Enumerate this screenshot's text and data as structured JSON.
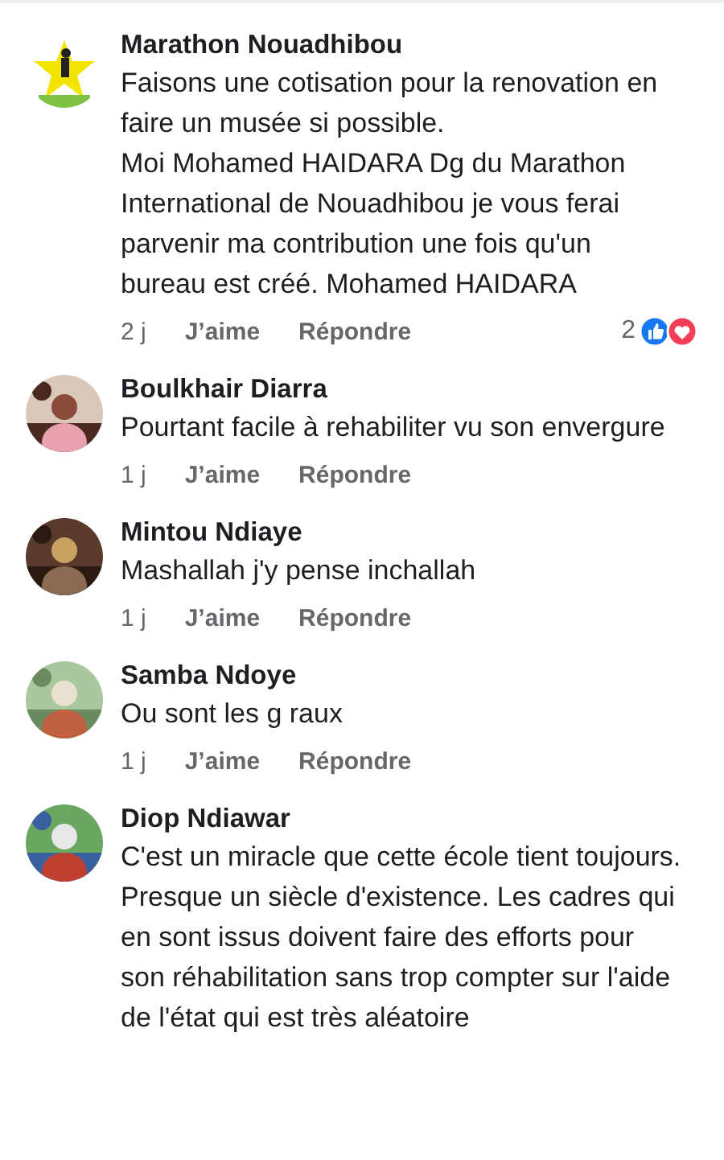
{
  "comments": [
    {
      "author": "Marathon Nouadhibou",
      "text": "Faisons une cotisation pour la renovation en faire un musée si possible.\nMoi Mohamed HAIDARA Dg du Marathon International de Nouadhibou je vous ferai parvenir ma contribution une fois qu'un bureau est créé. Mohamed HAIDARA",
      "time": "2 j",
      "like": "J’aime",
      "reply": "Répondre",
      "reaction_count": "2"
    },
    {
      "author": "Boulkhair Diarra",
      "text": "Pourtant facile à rehabiliter vu son envergure",
      "time": "1 j",
      "like": "J’aime",
      "reply": "Répondre"
    },
    {
      "author": "Mintou Ndiaye",
      "text": "Mashallah j'y pense inchallah",
      "time": "1 j",
      "like": "J’aime",
      "reply": "Répondre"
    },
    {
      "author": "Samba Ndoye",
      "text": "Ou sont les g raux",
      "time": "1 j",
      "like": "J’aime",
      "reply": "Répondre"
    },
    {
      "author": "Diop Ndiawar",
      "text": "C'est un miracle que cette école tient toujours. Presque un siècle d'existence. Les cadres qui en sont issus doivent faire des efforts pour son réhabilitation sans trop compter sur l'aide de l'état qui est très aléatoire"
    }
  ]
}
